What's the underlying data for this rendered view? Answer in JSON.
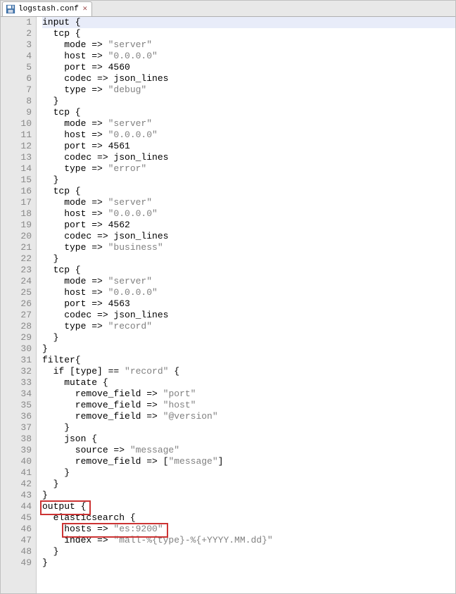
{
  "tab": {
    "filename": "logstash.conf"
  },
  "editor": {
    "currentLine": 1,
    "highlights": [
      {
        "line": 44,
        "text": "output {"
      },
      {
        "line": 46,
        "text": "hosts => \"es:9200\""
      }
    ],
    "lines": [
      {
        "n": 1,
        "seg": [
          {
            "t": "input {",
            "c": "k"
          }
        ]
      },
      {
        "n": 2,
        "seg": [
          {
            "t": "  tcp {",
            "c": "k"
          }
        ]
      },
      {
        "n": 3,
        "seg": [
          {
            "t": "    mode => ",
            "c": "k"
          },
          {
            "t": "\"server\"",
            "c": "str"
          }
        ]
      },
      {
        "n": 4,
        "seg": [
          {
            "t": "    host => ",
            "c": "k"
          },
          {
            "t": "\"0.0.0.0\"",
            "c": "str"
          }
        ]
      },
      {
        "n": 5,
        "seg": [
          {
            "t": "    port => 4560",
            "c": "k"
          }
        ]
      },
      {
        "n": 6,
        "seg": [
          {
            "t": "    codec => json_lines",
            "c": "k"
          }
        ]
      },
      {
        "n": 7,
        "seg": [
          {
            "t": "    type => ",
            "c": "k"
          },
          {
            "t": "\"debug\"",
            "c": "str"
          }
        ]
      },
      {
        "n": 8,
        "seg": [
          {
            "t": "  }",
            "c": "k"
          }
        ]
      },
      {
        "n": 9,
        "seg": [
          {
            "t": "  tcp {",
            "c": "k"
          }
        ]
      },
      {
        "n": 10,
        "seg": [
          {
            "t": "    mode => ",
            "c": "k"
          },
          {
            "t": "\"server\"",
            "c": "str"
          }
        ]
      },
      {
        "n": 11,
        "seg": [
          {
            "t": "    host => ",
            "c": "k"
          },
          {
            "t": "\"0.0.0.0\"",
            "c": "str"
          }
        ]
      },
      {
        "n": 12,
        "seg": [
          {
            "t": "    port => 4561",
            "c": "k"
          }
        ]
      },
      {
        "n": 13,
        "seg": [
          {
            "t": "    codec => json_lines",
            "c": "k"
          }
        ]
      },
      {
        "n": 14,
        "seg": [
          {
            "t": "    type => ",
            "c": "k"
          },
          {
            "t": "\"error\"",
            "c": "str"
          }
        ]
      },
      {
        "n": 15,
        "seg": [
          {
            "t": "  }",
            "c": "k"
          }
        ]
      },
      {
        "n": 16,
        "seg": [
          {
            "t": "  tcp {",
            "c": "k"
          }
        ]
      },
      {
        "n": 17,
        "seg": [
          {
            "t": "    mode => ",
            "c": "k"
          },
          {
            "t": "\"server\"",
            "c": "str"
          }
        ]
      },
      {
        "n": 18,
        "seg": [
          {
            "t": "    host => ",
            "c": "k"
          },
          {
            "t": "\"0.0.0.0\"",
            "c": "str"
          }
        ]
      },
      {
        "n": 19,
        "seg": [
          {
            "t": "    port => 4562",
            "c": "k"
          }
        ]
      },
      {
        "n": 20,
        "seg": [
          {
            "t": "    codec => json_lines",
            "c": "k"
          }
        ]
      },
      {
        "n": 21,
        "seg": [
          {
            "t": "    type => ",
            "c": "k"
          },
          {
            "t": "\"business\"",
            "c": "str"
          }
        ]
      },
      {
        "n": 22,
        "seg": [
          {
            "t": "  }",
            "c": "k"
          }
        ]
      },
      {
        "n": 23,
        "seg": [
          {
            "t": "  tcp {",
            "c": "k"
          }
        ]
      },
      {
        "n": 24,
        "seg": [
          {
            "t": "    mode => ",
            "c": "k"
          },
          {
            "t": "\"server\"",
            "c": "str"
          }
        ]
      },
      {
        "n": 25,
        "seg": [
          {
            "t": "    host => ",
            "c": "k"
          },
          {
            "t": "\"0.0.0.0\"",
            "c": "str"
          }
        ]
      },
      {
        "n": 26,
        "seg": [
          {
            "t": "    port => 4563",
            "c": "k"
          }
        ]
      },
      {
        "n": 27,
        "seg": [
          {
            "t": "    codec => json_lines",
            "c": "k"
          }
        ]
      },
      {
        "n": 28,
        "seg": [
          {
            "t": "    type => ",
            "c": "k"
          },
          {
            "t": "\"record\"",
            "c": "str"
          }
        ]
      },
      {
        "n": 29,
        "seg": [
          {
            "t": "  }",
            "c": "k"
          }
        ]
      },
      {
        "n": 30,
        "seg": [
          {
            "t": "}",
            "c": "k"
          }
        ]
      },
      {
        "n": 31,
        "seg": [
          {
            "t": "filter{",
            "c": "k"
          }
        ]
      },
      {
        "n": 32,
        "seg": [
          {
            "t": "  if [type] == ",
            "c": "k"
          },
          {
            "t": "\"record\"",
            "c": "str"
          },
          {
            "t": " {",
            "c": "k"
          }
        ]
      },
      {
        "n": 33,
        "seg": [
          {
            "t": "    mutate {",
            "c": "k"
          }
        ]
      },
      {
        "n": 34,
        "seg": [
          {
            "t": "      remove_field => ",
            "c": "k"
          },
          {
            "t": "\"port\"",
            "c": "str"
          }
        ]
      },
      {
        "n": 35,
        "seg": [
          {
            "t": "      remove_field => ",
            "c": "k"
          },
          {
            "t": "\"host\"",
            "c": "str"
          }
        ]
      },
      {
        "n": 36,
        "seg": [
          {
            "t": "      remove_field => ",
            "c": "k"
          },
          {
            "t": "\"@version\"",
            "c": "str"
          }
        ]
      },
      {
        "n": 37,
        "seg": [
          {
            "t": "    }",
            "c": "k"
          }
        ]
      },
      {
        "n": 38,
        "seg": [
          {
            "t": "    json {",
            "c": "k"
          }
        ]
      },
      {
        "n": 39,
        "seg": [
          {
            "t": "      source => ",
            "c": "k"
          },
          {
            "t": "\"message\"",
            "c": "str"
          }
        ]
      },
      {
        "n": 40,
        "seg": [
          {
            "t": "      remove_field => [",
            "c": "k"
          },
          {
            "t": "\"message\"",
            "c": "str"
          },
          {
            "t": "]",
            "c": "k"
          }
        ]
      },
      {
        "n": 41,
        "seg": [
          {
            "t": "    }",
            "c": "k"
          }
        ]
      },
      {
        "n": 42,
        "seg": [
          {
            "t": "  }",
            "c": "k"
          }
        ]
      },
      {
        "n": 43,
        "seg": [
          {
            "t": "}",
            "c": "k"
          }
        ]
      },
      {
        "n": 44,
        "seg": [
          {
            "t": "output {",
            "c": "k"
          }
        ]
      },
      {
        "n": 45,
        "seg": [
          {
            "t": "  elasticsearch {",
            "c": "k"
          }
        ]
      },
      {
        "n": 46,
        "seg": [
          {
            "t": "    hosts => ",
            "c": "k"
          },
          {
            "t": "\"es:9200\"",
            "c": "str"
          }
        ]
      },
      {
        "n": 47,
        "seg": [
          {
            "t": "    index => ",
            "c": "k"
          },
          {
            "t": "\"mall-%{type}-%{+YYYY.MM.dd}\"",
            "c": "str"
          }
        ]
      },
      {
        "n": 48,
        "seg": [
          {
            "t": "  }",
            "c": "k"
          }
        ]
      },
      {
        "n": 49,
        "seg": [
          {
            "t": "}",
            "c": "k"
          }
        ]
      }
    ]
  }
}
